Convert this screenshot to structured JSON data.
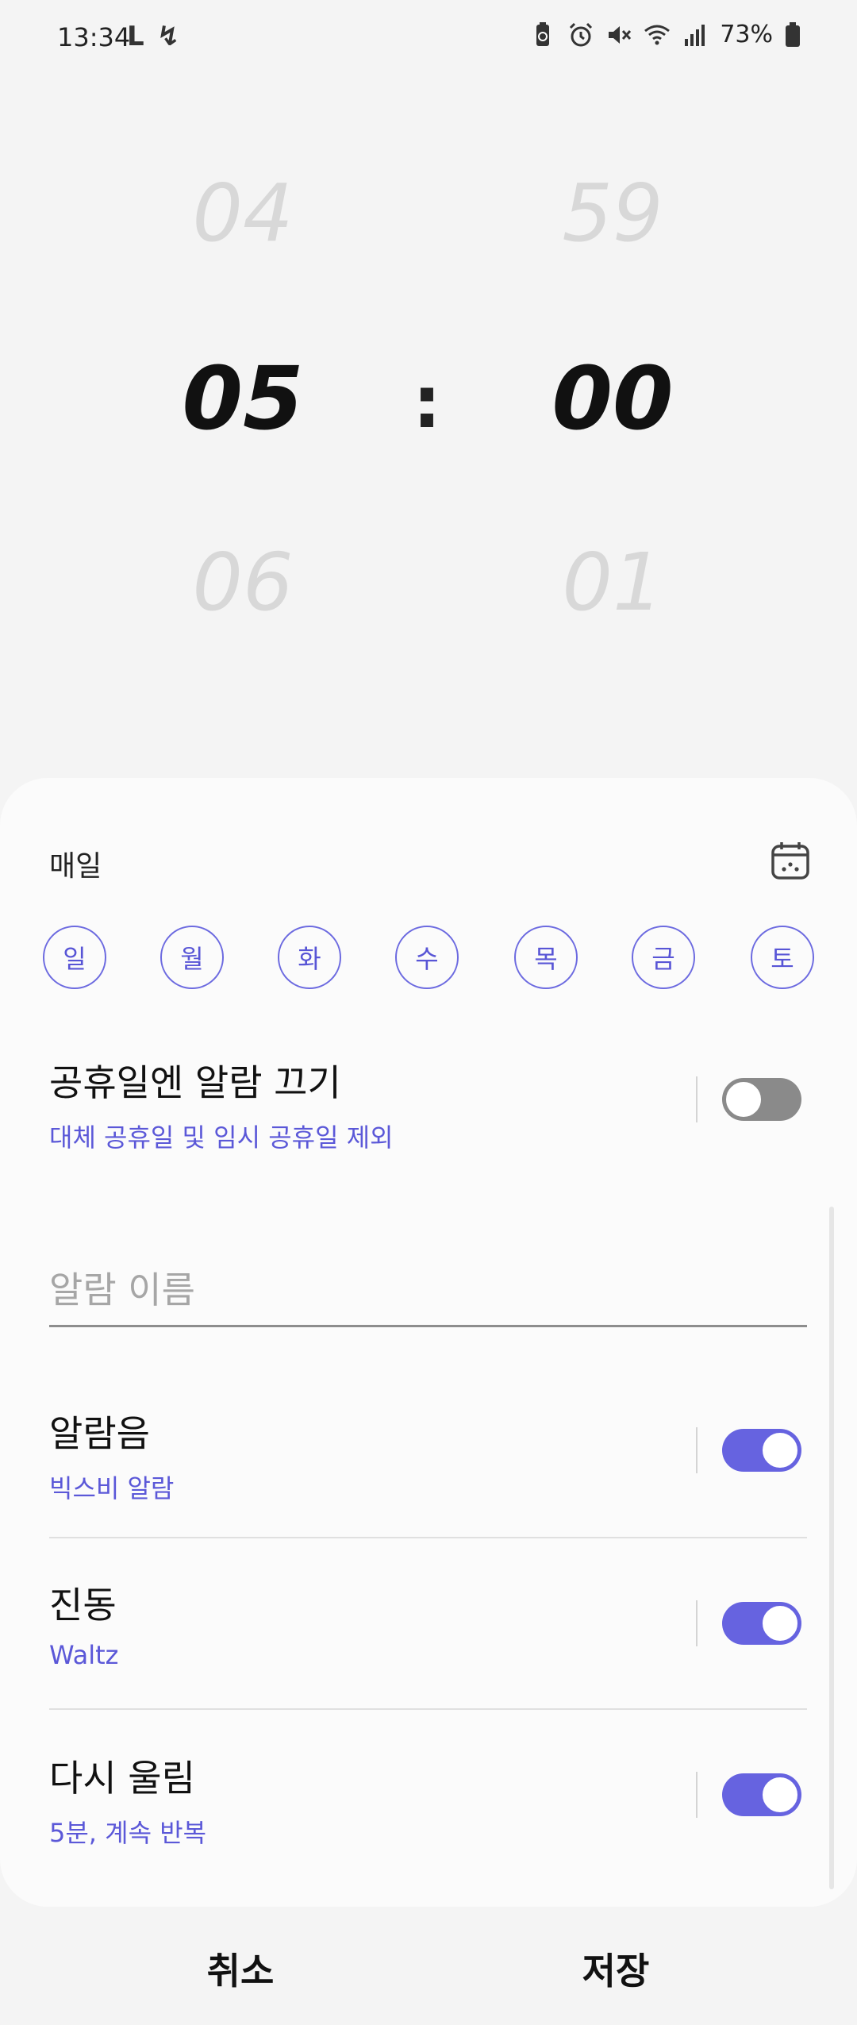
{
  "status_bar": {
    "time": "13:34",
    "left_icons": [
      "L",
      "↯"
    ],
    "right_icons": [
      "battery-saver-icon",
      "alarm-icon",
      "mute-icon",
      "wifi-icon",
      "signal-icon"
    ],
    "battery_text": "73%"
  },
  "picker": {
    "hour_prev": "04",
    "hour": "05",
    "hour_next": "06",
    "separator": ":",
    "minute_prev": "59",
    "minute": "00",
    "minute_next": "01"
  },
  "repeat": {
    "label": "매일",
    "days": [
      "일",
      "월",
      "화",
      "수",
      "목",
      "금",
      "토"
    ]
  },
  "holiday": {
    "title": "공휴일엔 알람 끄기",
    "subtitle": "대체 공휴일 및 임시 공휴일 제외",
    "enabled": false
  },
  "alarm_name": {
    "placeholder": "알람 이름",
    "value": ""
  },
  "sound": {
    "title": "알람음",
    "subtitle": "빅스비 알람",
    "enabled": true
  },
  "vibration": {
    "title": "진동",
    "subtitle": "Waltz",
    "enabled": true
  },
  "snooze": {
    "title": "다시 울림",
    "subtitle": "5분, 계속 반복",
    "enabled": true
  },
  "actions": {
    "cancel": "취소",
    "save": "저장"
  },
  "colors": {
    "accent": "#6663e0",
    "background": "#f4f4f4",
    "sheet": "#fbfbfb"
  }
}
